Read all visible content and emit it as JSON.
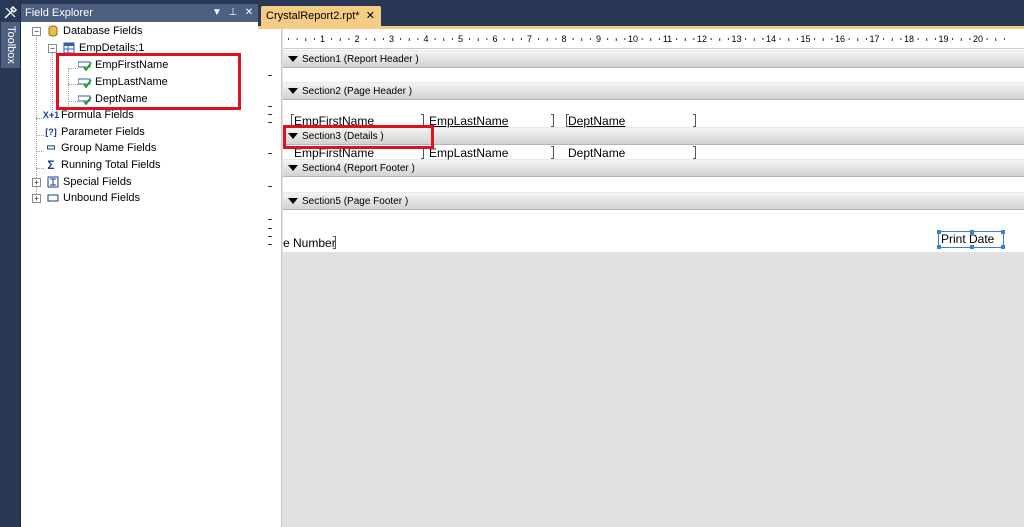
{
  "toolbox": {
    "label": "Toolbox",
    "icon": "toolbox-icon"
  },
  "field_explorer": {
    "title": "Field Explorer",
    "buttons": {
      "dropdown": "▼",
      "pin": "⊥",
      "close": "✕"
    },
    "tree": {
      "database_fields": "Database Fields",
      "table": "EmpDetails;1",
      "fields": [
        "EmpFirstName",
        "EmpLastName",
        "DeptName"
      ],
      "formula_fields": "Formula Fields",
      "parameter_fields": "Parameter Fields",
      "group_name_fields": "Group Name Fields",
      "running_total_fields": "Running Total Fields",
      "special_fields": "Special Fields",
      "unbound_fields": "Unbound Fields"
    },
    "icons": {
      "formula": "X+1",
      "parameter": "[?]",
      "group": "▭",
      "running": "Σ"
    }
  },
  "document": {
    "tab_title": "CrystalReport2.rpt*",
    "tab_close": "✕",
    "ruler_numbers": [
      "1",
      "2",
      "3",
      "4",
      "5",
      "6",
      "7",
      "8",
      "9",
      "10",
      "11",
      "12",
      "13",
      "14",
      "15",
      "16",
      "17",
      "18",
      "19",
      "20"
    ],
    "sections": [
      "Section1 (Report Header  )",
      "Section2 (Page Header  )",
      "Section3 (Details  )",
      "Section4 (Report Footer  )",
      "Section5 (Page Footer  )"
    ],
    "page_header_fields": [
      "EmpFirstName",
      "EmpLastName",
      "DeptName"
    ],
    "details_fields": [
      "EmpFirstName",
      "EmpLastName",
      "DeptName"
    ],
    "page_footer_left": "e Number",
    "page_footer_right": "Print Date"
  },
  "colors": {
    "chrome": "#293955",
    "panel_title": "#4d6082",
    "tab_active": "#f5cc84",
    "highlight": "#e01020"
  }
}
